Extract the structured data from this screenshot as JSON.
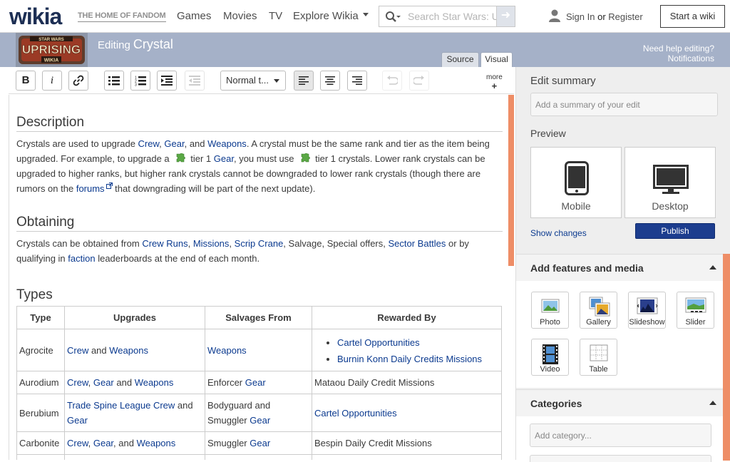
{
  "global_nav": {
    "logo": "wikia",
    "tagline": "THE HOME OF FANDOM",
    "links": [
      "Games",
      "Movies",
      "TV",
      "Explore Wikia"
    ],
    "search_placeholder": "Search Star Wars: Uprising",
    "sign_in": "Sign In",
    "or": "or",
    "register": "Register",
    "start_wiki": "Start a wiki"
  },
  "edit_header": {
    "editing_label": "Editing",
    "page_title": "Crystal",
    "help_link": "Need help editing?",
    "notifications": "Notifications",
    "tabs": [
      "Source",
      "Visual"
    ]
  },
  "toolbar": {
    "bold": "B",
    "italic": "i",
    "format_select": "Normal t...",
    "more": "more",
    "more_plus": "+"
  },
  "article": {
    "description": {
      "heading": "Description",
      "p1": "Crystals are used to upgrade ",
      "crew": "Crew",
      "comma1": ", ",
      "gear": "Gear",
      "and1": ", and ",
      "weapons": "Weapons",
      "p2": ". A crystal must be the same rank and tier as the item being upgraded. For example, to upgrade a",
      "p3": "tier 1 ",
      "gear2": "Gear",
      "p4": ", you must use",
      "p5": "tier 1 crystals. Lower rank crystals can be upgraded to higher ranks, but higher rank crystals cannot be downgraded to lower rank crystals (though there are rumors on the ",
      "forums": "forums",
      "p6": " that downgrading will be part of the next update)."
    },
    "obtaining": {
      "heading": "Obtaining",
      "p1": "Crystals can be obtained from ",
      "crew_runs": "Crew Runs",
      "c1": ", ",
      "missions": "Missions",
      "c2": ", ",
      "scrip_crane": "Scrip Crane",
      "p2": ", Salvage, Special offers, ",
      "sector_battles": "Sector Battles",
      "p3": " or by qualifying in ",
      "faction": "faction",
      "p4": " leaderboards at the end of each month."
    },
    "types": {
      "heading": "Types",
      "columns": [
        "Type",
        "Upgrades",
        "Salvages From",
        "Rewarded By"
      ],
      "rows": [
        {
          "type": "Agrocite",
          "u1": "Crew",
          "u_and": " and ",
          "u2": "Weapons",
          "salv": "Weapons",
          "rew1": "Cartel Opportunities",
          "rew2": "Burnin Konn Daily Credits Missions"
        },
        {
          "type": "Aurodium",
          "u1": "Crew",
          "u_c": ", ",
          "u2": "Gear",
          "u_and": " and ",
          "u3": "Weapons",
          "salv_pre": "Enforcer ",
          "salv": "Gear",
          "rew": "Mataou Daily Credit Missions"
        },
        {
          "type": "Berubium",
          "u1": "Trade Spine League Crew",
          "u_and": " and ",
          "u2": "Gear",
          "salv_pre": "Bodyguard and Smuggler ",
          "salv": "Gear",
          "rew": "Cartel Opportunities"
        },
        {
          "type": "Carbonite",
          "u1": "Crew",
          "u_c": ", ",
          "u2": "Gear",
          "u_and": ", and ",
          "u3": "Weapons",
          "salv_pre": "Smuggler ",
          "salv": "Gear",
          "rew": "Bespin Daily Credit Missions"
        }
      ]
    }
  },
  "rail": {
    "edit_summary_label": "Edit summary",
    "edit_summary_placeholder": "Add a summary of your edit",
    "preview_label": "Preview",
    "mobile": "Mobile",
    "desktop": "Desktop",
    "show_changes": "Show changes",
    "publish": "Publish",
    "features_heading": "Add features and media",
    "features": [
      "Photo",
      "Gallery",
      "Slideshow",
      "Slider",
      "Video",
      "Table"
    ],
    "categories_heading": "Categories",
    "category_placeholder": "Add category..."
  }
}
